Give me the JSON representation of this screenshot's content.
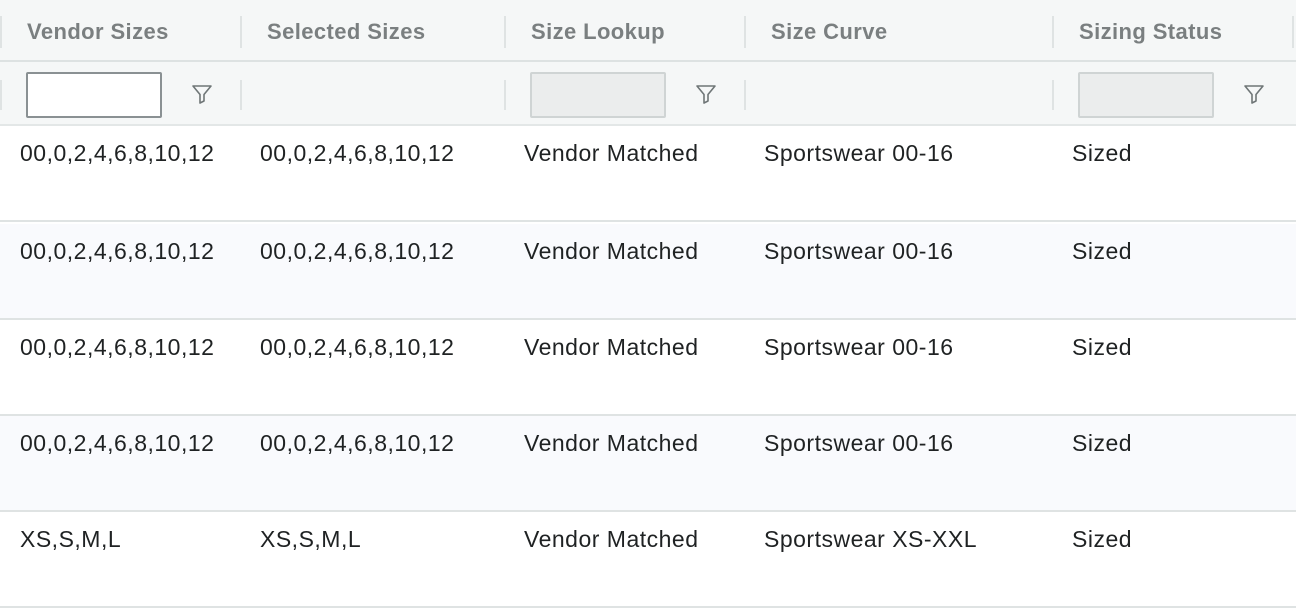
{
  "columns": [
    {
      "label": "Vendor Sizes"
    },
    {
      "label": "Selected Sizes"
    },
    {
      "label": "Size Lookup"
    },
    {
      "label": "Size Curve"
    },
    {
      "label": "Sizing Status"
    }
  ],
  "filters": {
    "vendor_sizes_value": "",
    "size_lookup_value": "",
    "sizing_status_value": ""
  },
  "rows": [
    {
      "vendor_sizes": "00,0,2,4,6,8,10,12",
      "selected_sizes": "00,0,2,4,6,8,10,12",
      "size_lookup": "Vendor Matched",
      "size_curve": "Sportswear 00-16",
      "sizing_status": "Sized"
    },
    {
      "vendor_sizes": "00,0,2,4,6,8,10,12",
      "selected_sizes": "00,0,2,4,6,8,10,12",
      "size_lookup": "Vendor Matched",
      "size_curve": "Sportswear 00-16",
      "sizing_status": "Sized"
    },
    {
      "vendor_sizes": "00,0,2,4,6,8,10,12",
      "selected_sizes": "00,0,2,4,6,8,10,12",
      "size_lookup": "Vendor Matched",
      "size_curve": "Sportswear 00-16",
      "sizing_status": "Sized"
    },
    {
      "vendor_sizes": "00,0,2,4,6,8,10,12",
      "selected_sizes": "00,0,2,4,6,8,10,12",
      "size_lookup": "Vendor Matched",
      "size_curve": "Sportswear 00-16",
      "sizing_status": "Sized"
    },
    {
      "vendor_sizes": "XS,S,M,L",
      "selected_sizes": "XS,S,M,L",
      "size_lookup": "Vendor Matched",
      "size_curve": "Sportswear XS-XXL",
      "sizing_status": "Sized"
    }
  ],
  "colors": {
    "header_bg": "#f5f7f7",
    "alt_row_bg": "#f9fafd",
    "header_text": "#7a7f80",
    "cell_text": "#1f2223"
  },
  "icons": {
    "filter": "filter-icon"
  }
}
